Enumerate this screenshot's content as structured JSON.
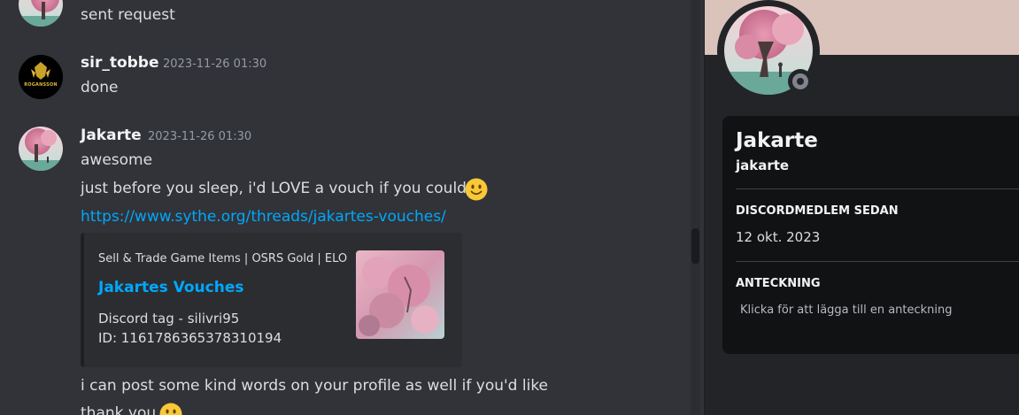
{
  "messages": [
    {
      "text": "sent request"
    },
    {
      "username": "sir_tobbe",
      "timestamp": "2023-11-26 01:30",
      "avatar_text": "ROGANSSON",
      "lines": [
        "done"
      ]
    },
    {
      "username": "Jakarte",
      "timestamp": "2023-11-26 01:30",
      "lines": [
        "awesome",
        "just before you sleep, i'd LOVE  a vouch if you could"
      ],
      "link": "https://www.sythe.org/threads/jakartes-vouches/",
      "embed": {
        "provider": "Sell & Trade Game Items | OSRS Gold | ELO",
        "title": "Jakartes Vouches",
        "desc_line1": "Discord tag - silivri95",
        "desc_line2": "ID: 1161786365378310194"
      },
      "after_lines": [
        "i can post some kind words on your profile as well if you'd like",
        "thank you"
      ]
    }
  ],
  "profile": {
    "display_name": "Jakarte",
    "username": "jakarte",
    "member_since_heading": "DISCORDMEDLEM SEDAN",
    "member_since": "12 okt. 2023",
    "note_heading": "ANTECKNING",
    "note_placeholder": "Klicka för att lägga till en anteckning",
    "status": "offline",
    "banner_color": "#d9c3bb"
  },
  "colors": {
    "link": "#00a8fc",
    "background": "#313338",
    "emoji": "#f8c838"
  },
  "icons": [
    "slightly-smiling-face-emoji",
    "status-offline-icon"
  ]
}
